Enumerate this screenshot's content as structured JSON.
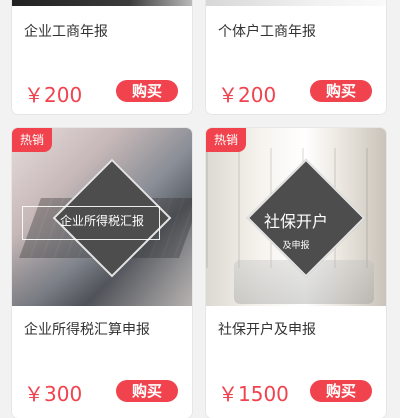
{
  "cards": [
    {
      "title": "企业工商年报",
      "price": "￥200",
      "button": "购买"
    },
    {
      "title": "个体户工商年报",
      "price": "￥200",
      "button": "购买"
    },
    {
      "badge": "热销",
      "image_text": "企业所得税汇报",
      "title": "企业所得税汇算申报",
      "price": "￥300",
      "button": "购买"
    },
    {
      "badge": "热销",
      "image_text_main": "社保开户",
      "image_text_sub": "及申报",
      "title": "社保开户及申报",
      "price": "￥1500",
      "button": "购买"
    }
  ],
  "colors": {
    "accent": "#f0434d",
    "text": "#333333",
    "background": "#f2f2f2"
  }
}
